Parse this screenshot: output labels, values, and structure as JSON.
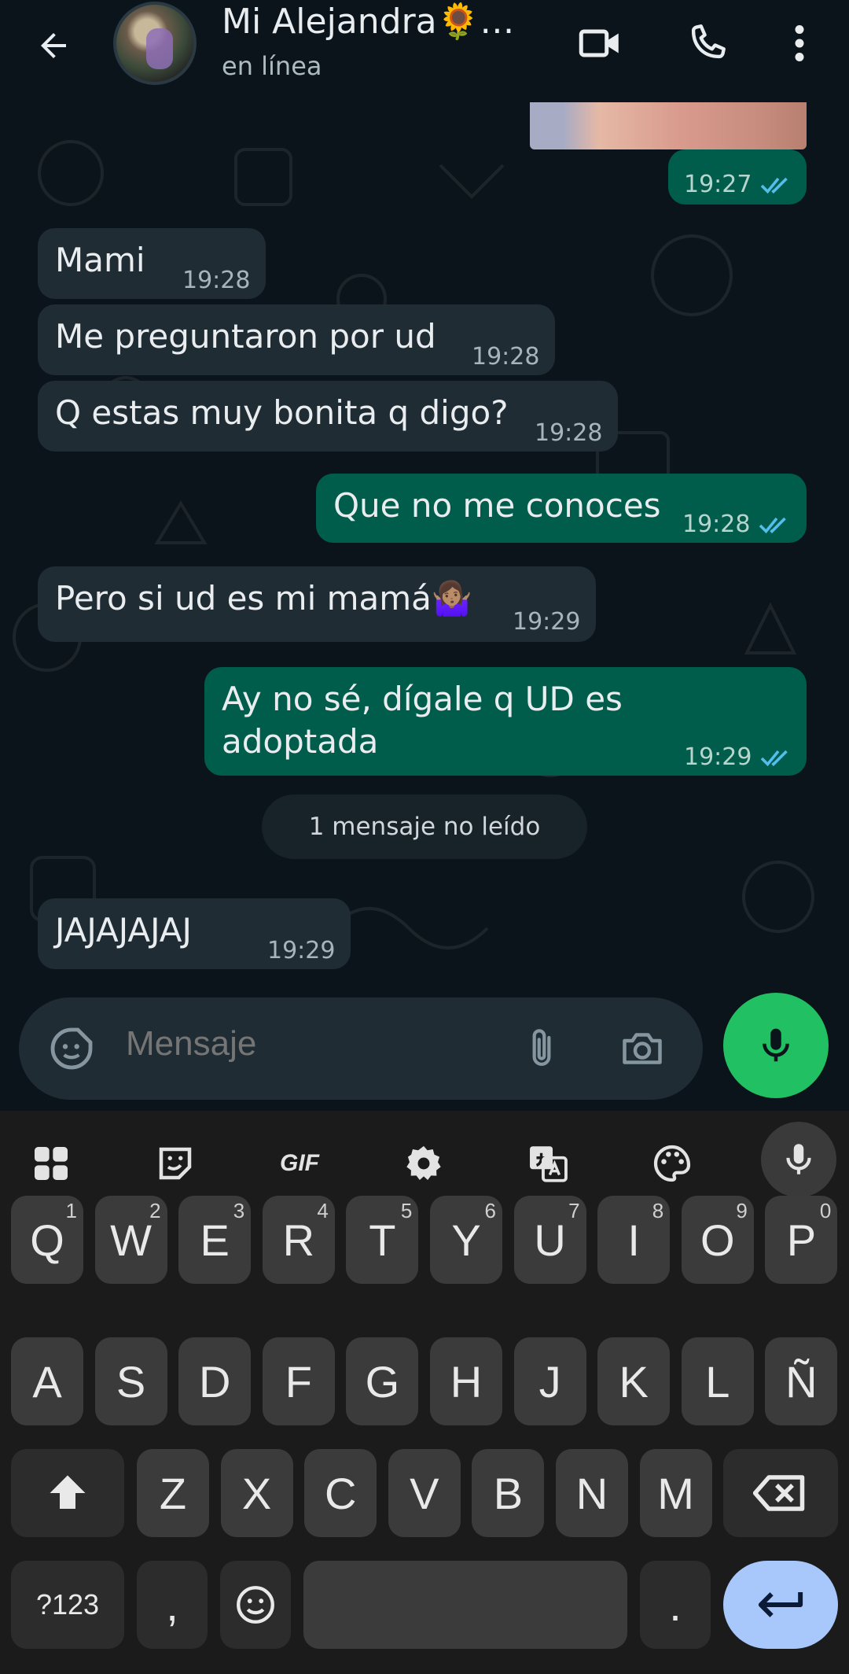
{
  "header": {
    "contact_name": "Mi Alejandra🌻…",
    "status": "en línea"
  },
  "messages": [
    {
      "dir": "out",
      "text": "",
      "time": "19:27",
      "ticks": "read"
    },
    {
      "dir": "in",
      "text": "Mami",
      "time": "19:28"
    },
    {
      "dir": "in",
      "text": "Me preguntaron por ud",
      "time": "19:28"
    },
    {
      "dir": "in",
      "text": "Q estas muy bonita q digo?",
      "time": "19:28"
    },
    {
      "dir": "out",
      "text": "Que no me conoces",
      "time": "19:28",
      "ticks": "read"
    },
    {
      "dir": "in",
      "text": "Pero si ud es mi mamá🤷🏽‍♀️",
      "time": "19:29"
    },
    {
      "dir": "out",
      "text": "Ay no sé, dígale q UD es adoptada",
      "time": "19:29",
      "ticks": "read"
    },
    {
      "dir": "in",
      "text": "JAJAJAJAJ",
      "time": "19:29"
    }
  ],
  "unread_banner": "1 mensaje no leído",
  "composer": {
    "placeholder": "Mensaje"
  },
  "keyboard": {
    "toolbar": [
      "apps-grid",
      "sticker",
      "GIF",
      "settings",
      "translate",
      "palette",
      "voice"
    ],
    "gif_label": "GIF",
    "row1": [
      {
        "k": "Q",
        "h": "1"
      },
      {
        "k": "W",
        "h": "2"
      },
      {
        "k": "E",
        "h": "3"
      },
      {
        "k": "R",
        "h": "4"
      },
      {
        "k": "T",
        "h": "5"
      },
      {
        "k": "Y",
        "h": "6"
      },
      {
        "k": "U",
        "h": "7"
      },
      {
        "k": "I",
        "h": "8"
      },
      {
        "k": "O",
        "h": "9"
      },
      {
        "k": "P",
        "h": "0"
      }
    ],
    "row2": [
      "A",
      "S",
      "D",
      "F",
      "G",
      "H",
      "J",
      "K",
      "L",
      "Ñ"
    ],
    "row3": [
      "Z",
      "X",
      "C",
      "V",
      "B",
      "N",
      "M"
    ],
    "symbols_label": "?123",
    "comma_label": ",",
    "period_label": "."
  },
  "colors": {
    "incoming_bubble": "#1f2c34",
    "outgoing_bubble": "#005c4b",
    "read_ticks": "#53bdeb",
    "mic_fab": "#21c063",
    "enter_key": "#a8c7fa"
  }
}
